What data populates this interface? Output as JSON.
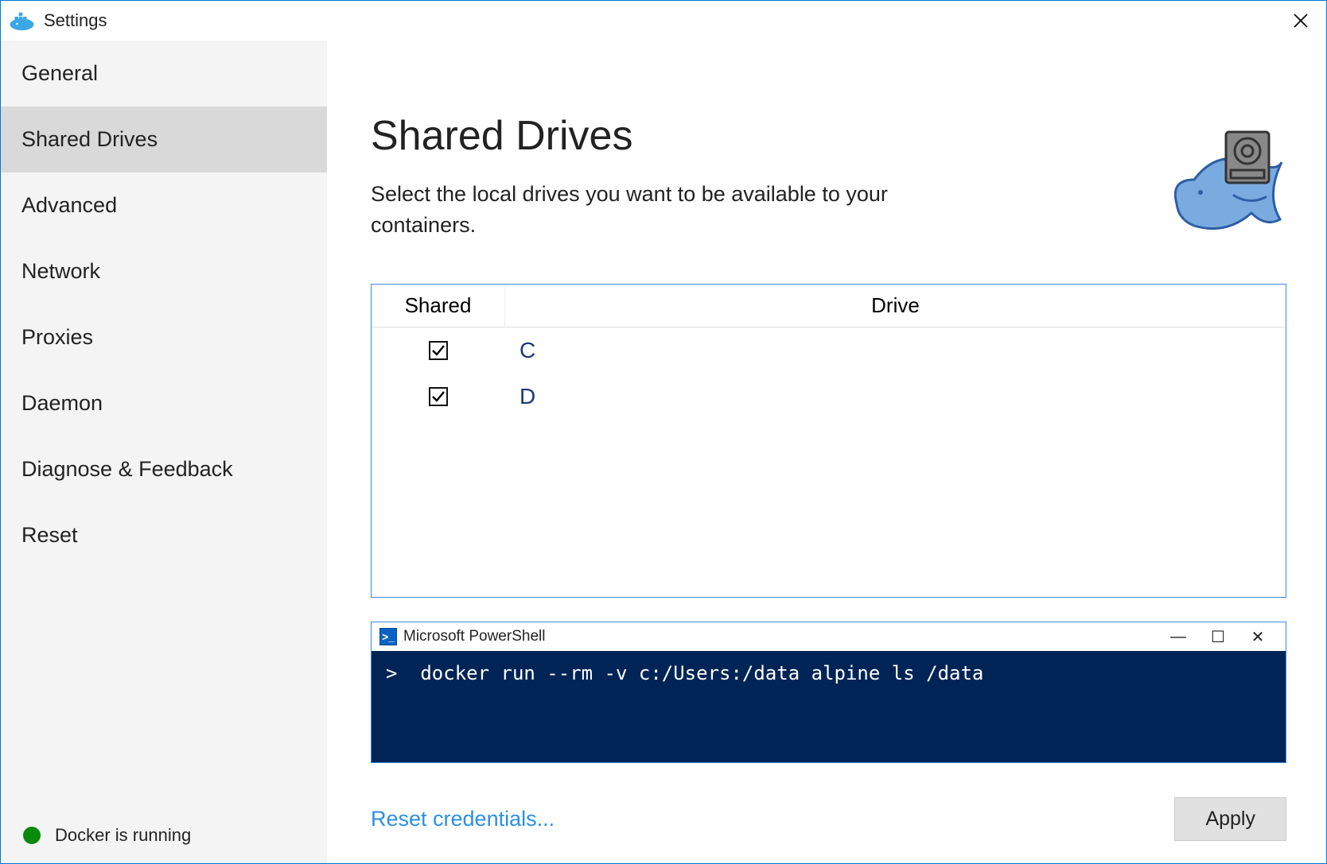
{
  "window": {
    "title": "Settings"
  },
  "sidebar": {
    "items": [
      {
        "label": "General"
      },
      {
        "label": "Shared Drives"
      },
      {
        "label": "Advanced"
      },
      {
        "label": "Network"
      },
      {
        "label": "Proxies"
      },
      {
        "label": "Daemon"
      },
      {
        "label": "Diagnose & Feedback"
      },
      {
        "label": "Reset"
      }
    ],
    "active_index": 1
  },
  "status": {
    "text": "Docker is running",
    "color": "#0a8a0a"
  },
  "page": {
    "title": "Shared Drives",
    "subtitle": "Select the local drives you want to be available to your containers."
  },
  "drives_table": {
    "columns": {
      "shared": "Shared",
      "drive": "Drive"
    },
    "rows": [
      {
        "shared": true,
        "drive": "C"
      },
      {
        "shared": true,
        "drive": "D"
      }
    ]
  },
  "powershell": {
    "title": "Microsoft PowerShell",
    "command": ">  docker run --rm -v c:/Users:/data alpine ls /data"
  },
  "footer": {
    "reset_link": "Reset credentials...",
    "apply_label": "Apply"
  }
}
